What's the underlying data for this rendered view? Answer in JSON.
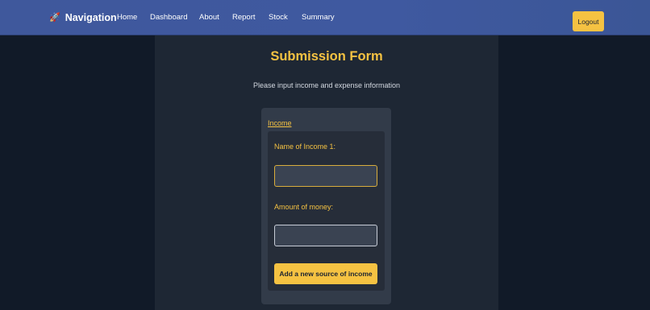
{
  "navbar": {
    "brand_icon": "rocket-icon",
    "brand_glyph": "🚀",
    "brand_label": "Navigation",
    "links": [
      "Home",
      "Dashboard",
      "About",
      "Report",
      "Stock",
      "Summary"
    ],
    "logout_label": "Logout"
  },
  "form": {
    "title": "Submission Form",
    "subtitle": "Please input income and expense information",
    "section_heading": "Income",
    "income_name_label": "Name of Income 1:",
    "income_name_value": "",
    "amount_label": "Amount of money:",
    "amount_value": "",
    "add_button_label": "Add a new source of income"
  },
  "colors": {
    "accent": "#f5c242",
    "navbar": "#3f589c",
    "page_background": "#111a28",
    "panel_background": "#1e2734"
  }
}
